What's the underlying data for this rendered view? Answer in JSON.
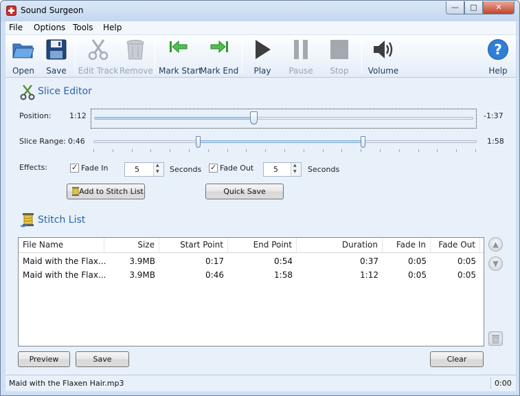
{
  "window": {
    "title": "Sound Surgeon",
    "buttons": {
      "minimize": "—",
      "maximize": "□",
      "close": "✕"
    }
  },
  "menu": [
    "File",
    "Options",
    "Tools",
    "Help"
  ],
  "toolbar": {
    "open": "Open",
    "save": "Save",
    "edit_track": "Edit Track",
    "remove": "Remove",
    "mark_start": "Mark Start",
    "mark_end": "Mark End",
    "play": "Play",
    "pause": "Pause",
    "stop": "Stop",
    "volume": "Volume",
    "help": "Help"
  },
  "slice_editor": {
    "title": "Slice Editor",
    "position_label": "Position:",
    "position_time": "1:12",
    "position_remaining": "-1:37",
    "position_fraction": 0.42,
    "range_label": "Slice Range:",
    "range_start": "0:46",
    "range_end": "1:58",
    "range_start_fraction": 0.27,
    "range_end_fraction": 0.7,
    "effects_label": "Effects:",
    "fade_in_label": "Fade In",
    "fade_in_checked": true,
    "fade_in_value": "5",
    "fade_out_label": "Fade Out",
    "fade_out_checked": true,
    "fade_out_value": "5",
    "seconds_label": "Seconds",
    "add_button": "Add to Stitch List",
    "quick_save_button": "Quick Save"
  },
  "stitch_list": {
    "title": "Stitch List",
    "columns": [
      "File Name",
      "Size",
      "Start Point",
      "End Point",
      "Duration",
      "Fade In",
      "Fade Out"
    ],
    "rows": [
      [
        "Maid with the Flax...",
        "3.9MB",
        "0:17",
        "0:54",
        "0:37",
        "0:05",
        "0:05"
      ],
      [
        "Maid with the Flax...",
        "3.9MB",
        "0:46",
        "1:58",
        "1:12",
        "0:05",
        "0:05"
      ]
    ],
    "preview_button": "Preview",
    "save_button": "Save",
    "clear_button": "Clear"
  },
  "status": {
    "file": "Maid with the Flaxen Hair.mp3",
    "time": "0:00"
  }
}
